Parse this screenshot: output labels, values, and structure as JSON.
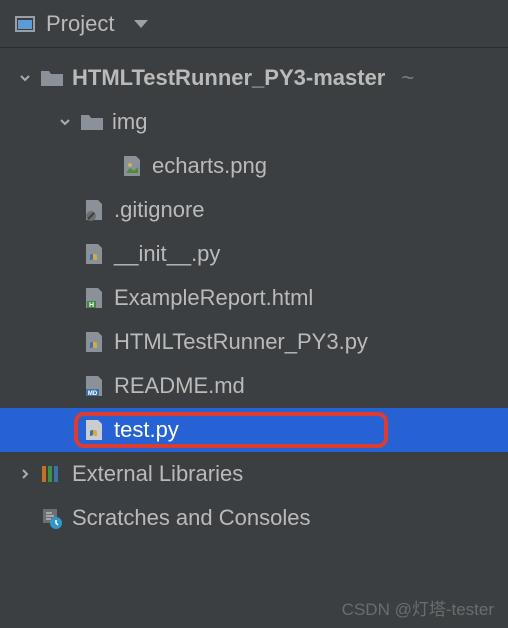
{
  "header": {
    "title": "Project"
  },
  "tree": {
    "project": {
      "name": "HTMLTestRunner_PY3-master",
      "suffix": "~"
    },
    "img_folder": "img",
    "img_file": "echarts.png",
    "files": {
      "gitignore": ".gitignore",
      "init": "__init__.py",
      "example": "ExampleReport.html",
      "runner": "HTMLTestRunner_PY3.py",
      "readme": "README.md",
      "test": "test.py"
    },
    "external": "External Libraries",
    "scratches": "Scratches and Consoles"
  },
  "watermark": "CSDN @灯塔-tester"
}
